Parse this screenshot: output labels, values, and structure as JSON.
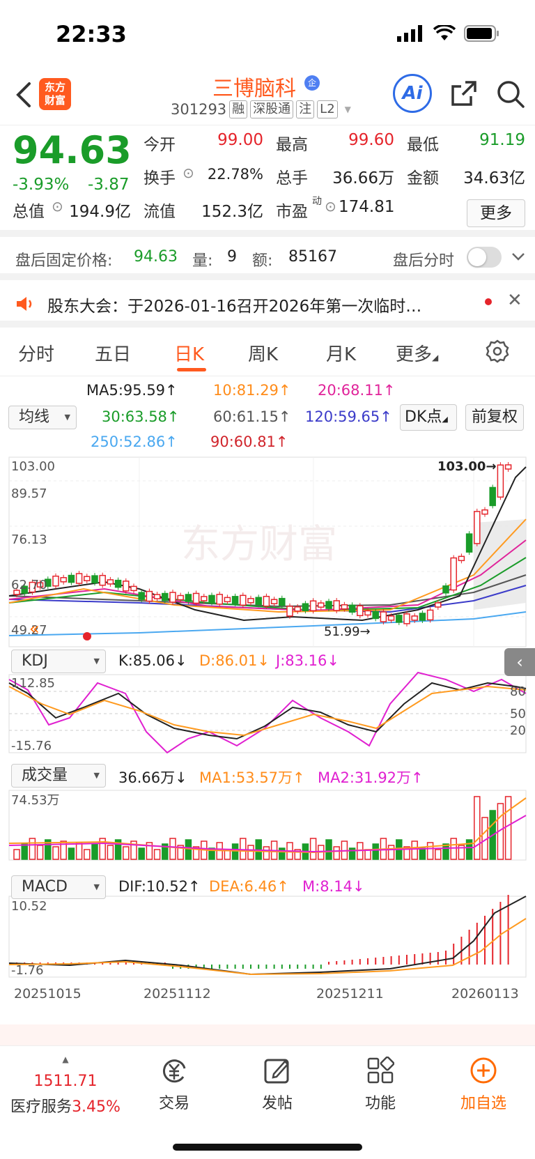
{
  "status": {
    "time": "22:33"
  },
  "header": {
    "logo_line1": "东方",
    "logo_line2": "财富",
    "name": "三博脑科",
    "enterprise_badge": "企",
    "code": "301293",
    "tags": [
      "融",
      "深股通",
      "注",
      "L2"
    ],
    "ai_label": "Ai"
  },
  "quote": {
    "price": "94.63",
    "change_pct": "-3.93%",
    "change_val": "-3.87",
    "open_label": "今开",
    "open": "99.00",
    "high_label": "最高",
    "high": "99.60",
    "low_label": "最低",
    "low": "91.19",
    "turnover_label": "换手",
    "turnover": "22.78%",
    "volume_label": "总手",
    "volume": "36.66万",
    "amount_label": "金额",
    "amount": "34.63亿",
    "mktcap_label": "总值",
    "mktcap": "194.9亿",
    "float_label": "流值",
    "float": "152.3亿",
    "pe_label": "市盈",
    "pe_sup": "动",
    "pe": "174.81",
    "more": "更多"
  },
  "after_hours": {
    "label": "盘后固定价格:",
    "price": "94.63",
    "vol_label": "量:",
    "vol": "9",
    "amt_label": "额:",
    "amt": "85167",
    "timeshare_label": "盘后分时"
  },
  "notice": {
    "text": "股东大会：于2026-01-16召开2026年第一次临时…"
  },
  "tabs": [
    "分时",
    "五日",
    "日K",
    "周K",
    "月K",
    "更多"
  ],
  "ma_legend": {
    "selector": "均线",
    "ma5": "MA5:95.59↑",
    "ma10": "10:81.29↑",
    "ma20": "20:68.11↑",
    "ma30": "30:63.58↑",
    "ma60": "60:61.15↑",
    "ma120": "120:59.65↑",
    "ma250": "250:52.86↑",
    "ma90": "90:60.81↑",
    "dk_button": "DK点",
    "fq_button": "前复权"
  },
  "chart_data": {
    "type": "candlestick",
    "price_axis": {
      "max": "103.00",
      "ticks": [
        "103.00",
        "89.57",
        "76.13",
        "62.70",
        "49.27"
      ],
      "min": 49.27
    },
    "annotations": {
      "high_marker": "103.00→",
      "low_marker": "51.99→"
    },
    "x_labels": [
      "20251015",
      "20251112",
      "20251211",
      "20260113"
    ],
    "colors": {
      "up": "#e5242b",
      "down": "#1a9c29",
      "ma5": "#222222",
      "ma10": "#ff9a1f",
      "ma20": "#e0239a",
      "ma30": "#1a9c29",
      "ma60": "#555555",
      "ma120": "#3b3bc9",
      "ma250": "#4aa8f0"
    }
  },
  "kdj": {
    "selector": "KDJ",
    "k": "K:85.06↓",
    "d": "D:86.01↓",
    "j": "J:83.16↓",
    "max": "112.85",
    "min": "-15.76",
    "levels": [
      "80",
      "50",
      "20"
    ]
  },
  "volume": {
    "selector": "成交量",
    "value": "36.66万↓",
    "ma1": "MA1:53.57万↑",
    "ma2": "MA2:31.92万↑",
    "max": "74.53万"
  },
  "macd": {
    "selector": "MACD",
    "dif": "DIF:10.52↑",
    "dea": "DEA:6.46↑",
    "m": "M:8.14↓",
    "max": "10.52",
    "min": "-1.76"
  },
  "bottom_bar": {
    "index_value": "1511.71",
    "index_name": "医疗服务",
    "index_pct": "3.45%",
    "trade": "交易",
    "post": "发帖",
    "functions": "功能",
    "add_watch": "加自选"
  }
}
